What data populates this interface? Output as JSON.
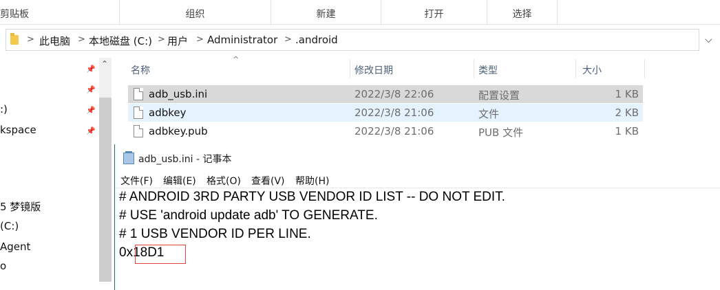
{
  "ribbon": {
    "groups": [
      "剪贴板",
      "组织",
      "新建",
      "打开",
      "选择"
    ]
  },
  "address": {
    "crumbs": [
      "此电脑",
      "本地磁盘 (C:)",
      "用户",
      "Administrator",
      ".android"
    ],
    "separator": ">",
    "dropdown_icon": "chevron-down-icon"
  },
  "nav": {
    "items": [
      ":)",
      "kspace",
      "5 梦镜版",
      "(C:)",
      "Agent",
      "o"
    ],
    "pin_icon": "pin-icon"
  },
  "columns": {
    "name": "名称",
    "modified": "修改日期",
    "type": "类型",
    "size": "大小"
  },
  "files": [
    {
      "name": "adb_usb.ini",
      "modified": "2022/3/8 22:06",
      "type": "配置设置",
      "size": "1 KB",
      "state": "selected"
    },
    {
      "name": "adbkey",
      "modified": "2022/3/8 21:06",
      "type": "文件",
      "size": "2 KB",
      "state": "hover"
    },
    {
      "name": "adbkey.pub",
      "modified": "2022/3/8 21:06",
      "type": "PUB 文件",
      "size": "1 KB",
      "state": "normal"
    }
  ],
  "notepad": {
    "title": "adb_usb.ini - 记事本",
    "menu": [
      "文件(F)",
      "编辑(E)",
      "格式(O)",
      "查看(V)",
      "帮助(H)"
    ],
    "lines": [
      "# ANDROID 3RD PARTY USB VENDOR ID LIST -- DO NOT EDIT.",
      "# USE 'android update adb' TO GENERATE.",
      "# 1 USB VENDOR ID PER LINE.",
      "0x18D1"
    ],
    "highlight_color": "#e0443c"
  }
}
